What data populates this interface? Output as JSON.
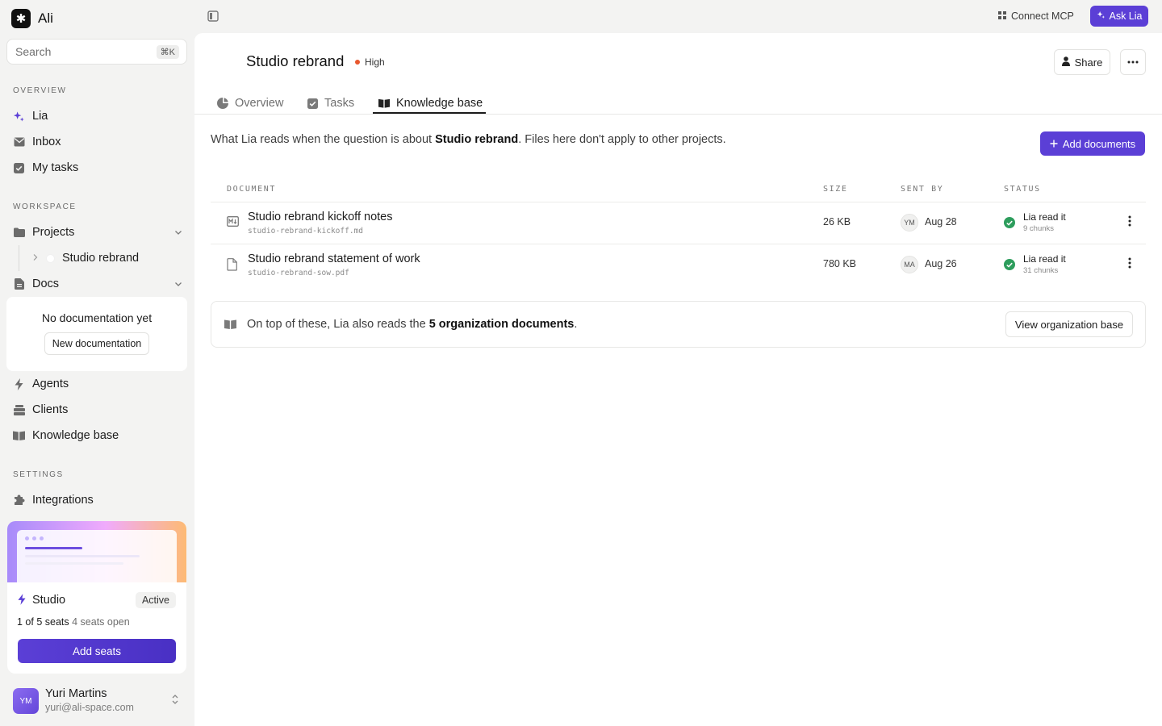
{
  "app": {
    "name": "Ali",
    "logo_glyph": "✱"
  },
  "search": {
    "placeholder": "Search",
    "shortcut": "⌘K"
  },
  "sidebar": {
    "overview_label": "OVERVIEW",
    "overview_items": [
      {
        "label": "Lia",
        "icon": "sparkle-icon"
      },
      {
        "label": "Inbox",
        "icon": "mail-icon"
      },
      {
        "label": "My tasks",
        "icon": "checkbox-icon"
      }
    ],
    "workspace_label": "WORKSPACE",
    "projects_label": "Projects",
    "project_sub_item": "Studio rebrand",
    "docs_label": "Docs",
    "docs_empty_text": "No documentation yet",
    "new_doc_label": "New documentation",
    "workspace_items": [
      {
        "label": "Agents",
        "icon": "bolt-icon"
      },
      {
        "label": "Clients",
        "icon": "stack-icon"
      },
      {
        "label": "Knowledge base",
        "icon": "book-icon"
      }
    ],
    "settings_label": "SETTINGS",
    "integrations_label": "Integrations"
  },
  "plan": {
    "name": "Studio",
    "status": "Active",
    "seats_used": "1 of 5 seats",
    "seats_open": "4 seats open",
    "seats_fill": 0.2,
    "add_seats_label": "Add seats"
  },
  "user": {
    "initials": "YM",
    "name": "Yuri Martins",
    "email": "yuri@ali-space.com"
  },
  "topbar": {
    "connect_mcp": "Connect MCP",
    "ask_lia": "Ask Lia"
  },
  "project": {
    "title": "Studio rebrand",
    "priority": "High",
    "share_label": "Share",
    "more_glyph": "•••"
  },
  "tabs": [
    {
      "label": "Overview",
      "icon": "pie-icon",
      "active": false
    },
    {
      "label": "Tasks",
      "icon": "checkbox-icon",
      "active": false
    },
    {
      "label": "Knowledge base",
      "icon": "book-icon",
      "active": true
    }
  ],
  "kb": {
    "desc_prefix": "What Lia reads when the question is about ",
    "desc_project": "Studio rebrand",
    "desc_suffix": ". Files here don't apply to other projects.",
    "add_documents_label": "Add documents",
    "columns": {
      "document": "DOCUMENT",
      "size": "SIZE",
      "sent_by": "SENT BY",
      "status": "STATUS"
    },
    "documents": [
      {
        "name": "Studio rebrand kickoff notes",
        "file": "studio-rebrand-kickoff.md",
        "type": "markdown-file-icon",
        "size": "26 KB",
        "sender_initials": "YM",
        "date": "Aug 28",
        "status": "Lia read it",
        "chunks": "9 chunks"
      },
      {
        "name": "Studio rebrand statement of work",
        "file": "studio-rebrand-sow.pdf",
        "type": "pdf-file-icon",
        "size": "780 KB",
        "sender_initials": "MA",
        "date": "Aug 26",
        "status": "Lia read it",
        "chunks": "31 chunks"
      }
    ],
    "org_prefix": "On top of these, Lia also reads the ",
    "org_count": "5 organization documents",
    "org_suffix": ".",
    "org_button": "View organization base"
  },
  "colors": {
    "accent": "#5b3fd6",
    "priority_high": "#e8572d",
    "status_ok": "#2d9d5c",
    "sidebar_bg": "#f3f3f2",
    "panel_bg": "#ffffff"
  }
}
